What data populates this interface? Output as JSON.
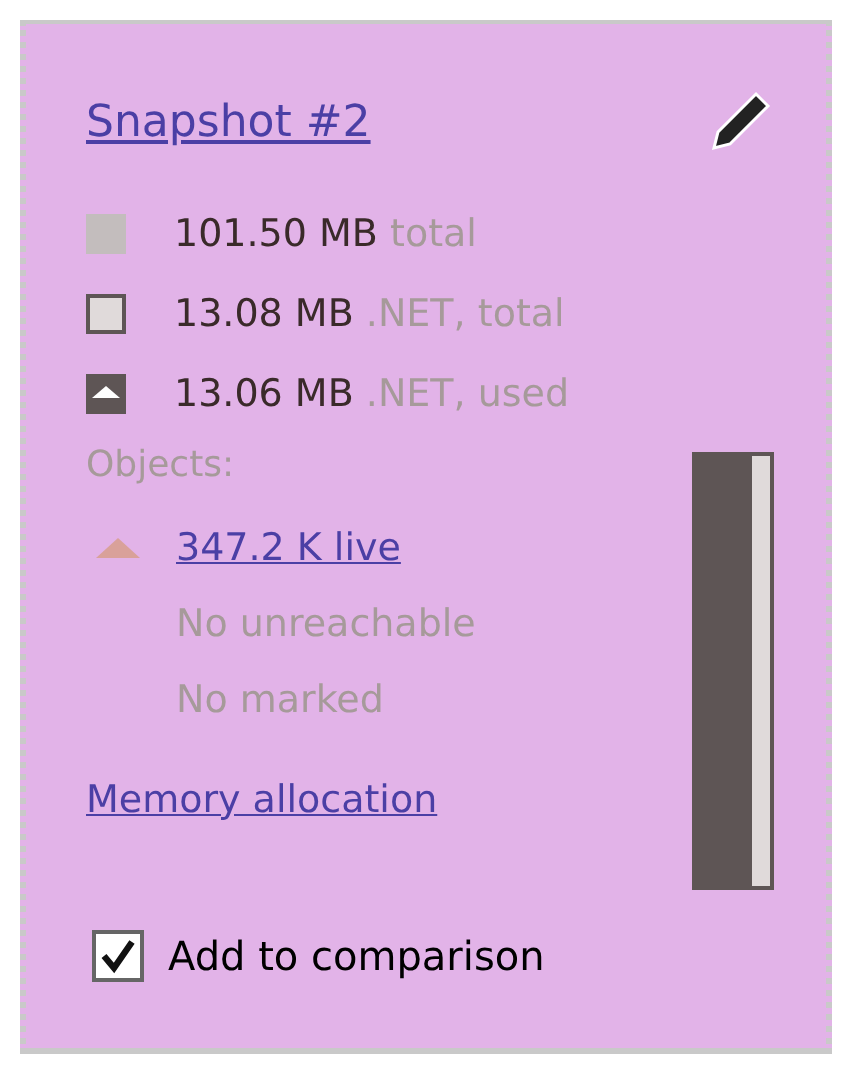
{
  "title": "Snapshot #2",
  "legend": [
    {
      "kind": "total",
      "value": "101.50 MB",
      "label": "total"
    },
    {
      "kind": "net-total",
      "value": "13.08 MB",
      "label": ".NET, total"
    },
    {
      "kind": "net-used",
      "value": "13.06 MB",
      "label": ".NET, used"
    }
  ],
  "objects_label": "Objects:",
  "live_objects": "347.2 K live",
  "notes": [
    "No unreachable",
    "No marked"
  ],
  "memory_link": "Memory allocation",
  "compare": {
    "label": "Add to comparison",
    "checked": true
  }
}
